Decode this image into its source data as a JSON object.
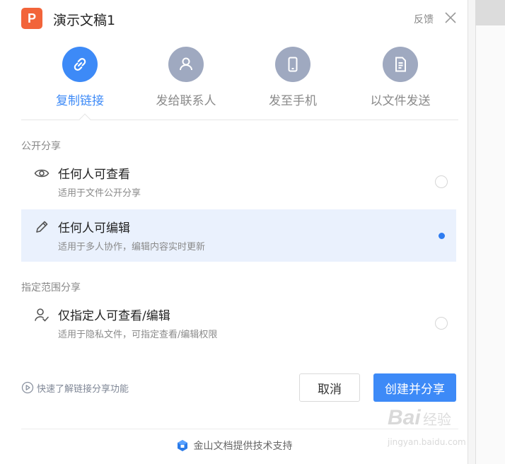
{
  "window": {
    "title": "演示文稿1",
    "app_logo_letter": "P",
    "feedback_label": "反馈"
  },
  "tabs": [
    {
      "label": "复制链接",
      "icon": "link-icon",
      "active": true
    },
    {
      "label": "发给联系人",
      "icon": "contact-icon",
      "active": false
    },
    {
      "label": "发至手机",
      "icon": "phone-icon",
      "active": false
    },
    {
      "label": "以文件发送",
      "icon": "file-icon",
      "active": false
    }
  ],
  "public_section": {
    "label": "公开分享",
    "options": [
      {
        "title": "任何人可查看",
        "desc": "适用于文件公开分享",
        "icon": "eye-icon",
        "selected": false
      },
      {
        "title": "任何人可编辑",
        "desc": "适用于多人协作，编辑内容实时更新",
        "icon": "pencil-icon",
        "selected": true
      }
    ]
  },
  "scoped_section": {
    "label": "指定范围分享",
    "options": [
      {
        "title": "仅指定人可查看/编辑",
        "desc": "适用于隐私文件，可指定查看/编辑权限",
        "icon": "user-check-icon",
        "selected": false
      }
    ]
  },
  "footer": {
    "learn_link": "快速了解链接分享功能",
    "cancel_label": "取消",
    "create_label": "创建并分享",
    "powered_by": "金山文档提供技术支持"
  },
  "watermark": {
    "logo": "Bai",
    "sub": "经验",
    "url": "jingyan.baidu.com"
  },
  "colors": {
    "accent": "#3d8af7",
    "app_logo": "#f2643a",
    "tab_inactive": "#9fa9c0",
    "selected_row": "#eaf1fd"
  }
}
